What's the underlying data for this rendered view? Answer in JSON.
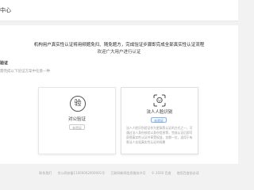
{
  "header": {
    "title": "中心"
  },
  "notice": {
    "line1": "机构用户真实性认证将用频题免扫、随免题方，完成验证步骤即完成全部真实性认证流程",
    "line2": "欢迎广大用户进行认证"
  },
  "section": {
    "label": "验证",
    "tip": "需完成以下验证方案中任意一种"
  },
  "cards": {
    "corp": {
      "badge_char": "验",
      "name": "对公验证",
      "tag": "未验证"
    },
    "face": {
      "icon": "face-scan-icon",
      "name": "法人人脸识别",
      "tag": "去验证",
      "desc": "法人人脸识别验证作为更高等认证的方式之一，可通过法人身份核验以身份信息等，完成认证后即可获得真实性认证并享受权益，仅需一位，适用于有需法人实现真实性认证的场景"
    }
  },
  "footer": {
    "items": [
      "联系我们",
      "京公网安备11000002000001号",
      "互联网新闻信息服务许可",
      "© 2020 百度",
      "使用百度前必读"
    ]
  },
  "colors": {
    "accent": "#4a8fdb",
    "background": "#f2f2f2"
  }
}
